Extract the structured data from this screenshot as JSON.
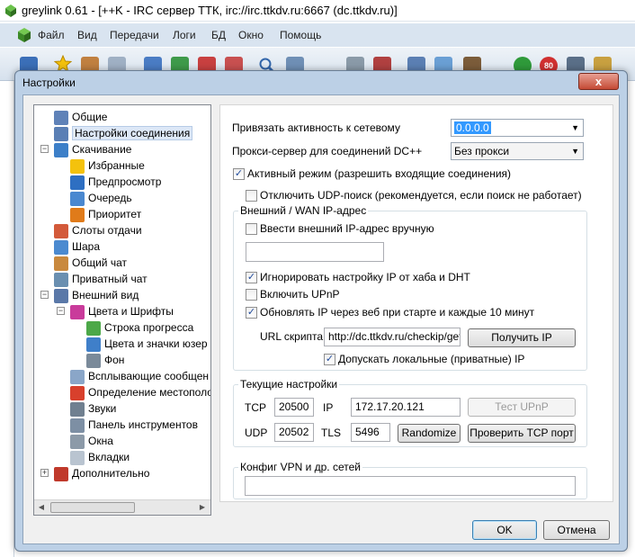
{
  "window": {
    "title": "greylink 0.61 - [++K - IRC сервер ТТК, irc://irc.ttkdv.ru:6667 (dc.ttkdv.ru)]"
  },
  "menu": [
    "Файл",
    "Вид",
    "Передачи",
    "Логи",
    "БД",
    "Окно",
    "Помощь"
  ],
  "toolbar": {
    "icons": [
      "connect-icon",
      "favorites-icon",
      "users-icon",
      "clock-icon",
      "download-icon",
      "download-queue-icon",
      "upload-icon",
      "finished-icon",
      "search-icon",
      "filelist-icon",
      "notepad-icon",
      "network-icon",
      "settings-icon",
      "edit-icon",
      "user-icon",
      "power-icon",
      "limit-80-icon",
      "home-icon",
      "bell-icon"
    ],
    "limit_label": "80"
  },
  "dialog": {
    "title": "Настройки",
    "close_label": "x",
    "ok_label": "OK",
    "cancel_label": "Отмена"
  },
  "tree": {
    "items": [
      {
        "label": "Общие",
        "icon": "general-icon"
      },
      {
        "label": "Настройки соединения",
        "icon": "connection-icon"
      },
      {
        "label": "Скачивание",
        "icon": "download-icon"
      },
      {
        "label": "Избранные",
        "icon": "star-icon"
      },
      {
        "label": "Предпросмотр",
        "icon": "preview-icon"
      },
      {
        "label": "Очередь",
        "icon": "queue-icon"
      },
      {
        "label": "Приоритет",
        "icon": "priority-icon"
      },
      {
        "label": "Слоты отдачи",
        "icon": "upload-slots-icon"
      },
      {
        "label": "Шара",
        "icon": "share-icon"
      },
      {
        "label": "Общий чат",
        "icon": "chat-icon"
      },
      {
        "label": "Приватный чат",
        "icon": "private-chat-icon"
      },
      {
        "label": "Внешний вид",
        "icon": "appearance-icon"
      },
      {
        "label": "Цвета и Шрифты",
        "icon": "palette-icon"
      },
      {
        "label": "Строка прогресса",
        "icon": "progress-icon"
      },
      {
        "label": "Цвета и значки юзер",
        "icon": "user-colors-icon"
      },
      {
        "label": "Фон",
        "icon": "background-icon"
      },
      {
        "label": "Всплывающие сообщен",
        "icon": "popup-icon"
      },
      {
        "label": "Определение местополо",
        "icon": "location-icon"
      },
      {
        "label": "Звуки",
        "icon": "sound-icon"
      },
      {
        "label": "Панель инструментов",
        "icon": "toolbar-icon"
      },
      {
        "label": "Окна",
        "icon": "windows-icon"
      },
      {
        "label": "Вкладки",
        "icon": "tabs-icon"
      },
      {
        "label": "Дополнительно",
        "icon": "advanced-icon"
      }
    ]
  },
  "settings": {
    "bind_label": "Привязать активность к сетевому",
    "bind_value": "0.0.0.0",
    "proxy_label": "Прокси-сервер для соединений DC++",
    "proxy_value": "Без прокси",
    "active_mode_label": "Активный режим (разрешить входящие соединения)",
    "active_mode_checked": true,
    "disable_udp_label": "Отключить UDP-поиск (рекомендуется, если поиск не работает)",
    "disable_udp_checked": false,
    "wan_group": {
      "title": "Внешний / WAN IP-адрес",
      "manual_label": "Ввести внешний IP-адрес вручную",
      "manual_checked": false,
      "manual_value": "",
      "ignore_hub_label": "Игнорировать настройку IP от хаба и DHT",
      "ignore_hub_checked": true,
      "upnp_label": "Включить UPnP",
      "upnp_checked": false,
      "update_web_label": "Обновлять IP через веб при старте и каждые 10 минут",
      "update_web_checked": true,
      "script_url_label": "URL скрипта:",
      "script_url_value": "http://dc.ttkdv.ru/checkip/get",
      "get_ip_button": "Получить IP",
      "allow_local_label": "Допускать локальные (приватные) IP",
      "allow_local_checked": true
    },
    "current_group": {
      "title": "Текущие настройки",
      "tcp_label": "TCP",
      "tcp_value": "20500",
      "ip_label": "IP",
      "ip_value": "172.17.20.121",
      "test_upnp_button": "Тест UPnP",
      "udp_label": "UDP",
      "udp_value": "20502",
      "tls_label": "TLS",
      "tls_value": "5496",
      "randomize_button": "Randomize",
      "check_tcp_button": "Проверить TCP порт"
    },
    "vpn_group": {
      "title": "Конфиг VPN и др. сетей",
      "value": ""
    }
  },
  "check_glyph": "✓",
  "scroll": {
    "left_arrow": "◀",
    "right_arrow": "▶"
  }
}
